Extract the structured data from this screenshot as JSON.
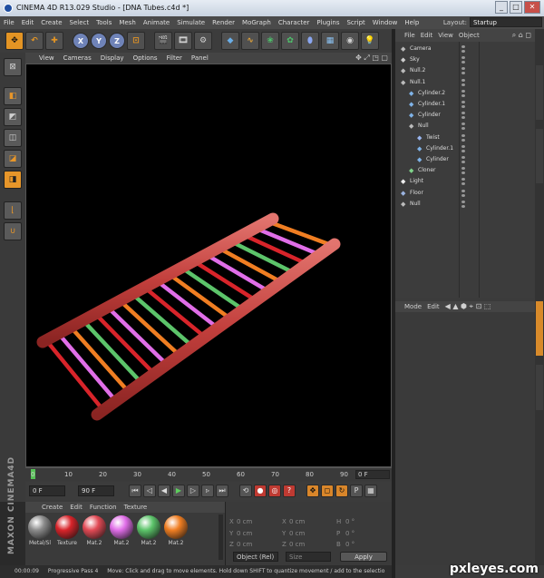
{
  "window": {
    "title": "CINEMA 4D R13.029 Studio - [DNA Tubes.c4d *]",
    "controls": [
      "_",
      "□",
      "✕"
    ]
  },
  "menu": [
    "File",
    "Edit",
    "Create",
    "Select",
    "Tools",
    "Mesh",
    "Animate",
    "Simulate",
    "Render",
    "MoGraph",
    "Character",
    "Plugins",
    "Script",
    "Window",
    "Help"
  ],
  "layout": {
    "label": "Layout:",
    "value": "Startup"
  },
  "toolbar": {
    "axes": [
      "X",
      "Y",
      "Z"
    ]
  },
  "viewport": {
    "menu": [
      "View",
      "Cameras",
      "Display",
      "Options",
      "Filter",
      "Panel"
    ]
  },
  "timeline": {
    "ticks": [
      "0",
      "10",
      "20",
      "30",
      "40",
      "50",
      "60",
      "70",
      "80",
      "90"
    ],
    "current_frame": "0 F"
  },
  "transport": {
    "start_field": "0 F",
    "end_field": "90 F"
  },
  "materials": {
    "menu": [
      "Create",
      "Edit",
      "Function",
      "Texture"
    ],
    "items": [
      {
        "label": "Metal/Sl",
        "color": "#8c8c8c"
      },
      {
        "label": "Texture",
        "color": "#d8242a"
      },
      {
        "label": "Mat.2",
        "color": "#e24a55"
      },
      {
        "label": "Mat.2",
        "color": "#e06ee8"
      },
      {
        "label": "Mat.2",
        "color": "#5cc46a"
      },
      {
        "label": "Mat.2",
        "color": "#f07e22"
      }
    ]
  },
  "coords": {
    "rows": [
      {
        "a": "X",
        "av": "0 cm",
        "b": "X",
        "bv": "0 cm",
        "c": "H",
        "cv": "0 °"
      },
      {
        "a": "Y",
        "av": "0 cm",
        "b": "Y",
        "bv": "0 cm",
        "c": "P",
        "cv": "0 °"
      },
      {
        "a": "Z",
        "av": "0 cm",
        "b": "Z",
        "bv": "0 cm",
        "c": "B",
        "cv": "0 °"
      }
    ],
    "object_select": "Object (Rel)",
    "size_select": "Size",
    "apply": "Apply"
  },
  "status": {
    "time": "00:00:09",
    "pass": "Progressive Pass 4",
    "message": "Move: Click and drag to move elements. Hold down SHIFT to quantize movement / add to the selectio"
  },
  "object_manager": {
    "menu": [
      "File",
      "Edit",
      "View",
      "Object"
    ],
    "objects": [
      {
        "name": "Camera",
        "indent": 0,
        "icon": "camera-icon",
        "ic": "#bbb"
      },
      {
        "name": "Sky",
        "indent": 0,
        "icon": "sky-icon",
        "ic": "#ccc"
      },
      {
        "name": "Null.2",
        "indent": 0,
        "icon": "null-icon",
        "ic": "#bbb"
      },
      {
        "name": "Null.1",
        "indent": 0,
        "icon": "null-icon",
        "ic": "#bbb"
      },
      {
        "name": "Cylinder.2",
        "indent": 1,
        "icon": "cylinder-icon",
        "ic": "#7fb3e8"
      },
      {
        "name": "Cylinder.1",
        "indent": 1,
        "icon": "cylinder-icon",
        "ic": "#7fb3e8"
      },
      {
        "name": "Cylinder",
        "indent": 1,
        "icon": "cylinder-icon",
        "ic": "#7fb3e8"
      },
      {
        "name": "Null",
        "indent": 1,
        "icon": "null-icon",
        "ic": "#bbb"
      },
      {
        "name": "Twist",
        "indent": 2,
        "icon": "twist-icon",
        "ic": "#9ab6f0"
      },
      {
        "name": "Cylinder.1",
        "indent": 2,
        "icon": "cylinder-icon",
        "ic": "#7fb3e8"
      },
      {
        "name": "Cylinder",
        "indent": 2,
        "icon": "cylinder-icon",
        "ic": "#7fb3e8"
      },
      {
        "name": "Cloner",
        "indent": 1,
        "icon": "cloner-icon",
        "ic": "#7fd38a"
      },
      {
        "name": "Light",
        "indent": 0,
        "icon": "light-icon",
        "ic": "#eee"
      },
      {
        "name": "Floor",
        "indent": 0,
        "icon": "floor-icon",
        "ic": "#9bb4e0"
      },
      {
        "name": "Null",
        "indent": 0,
        "icon": "null-icon",
        "ic": "#bbb"
      }
    ]
  },
  "attributes": {
    "menu": [
      "Mode",
      "Edit"
    ]
  },
  "watermark": "pxleyes.com"
}
